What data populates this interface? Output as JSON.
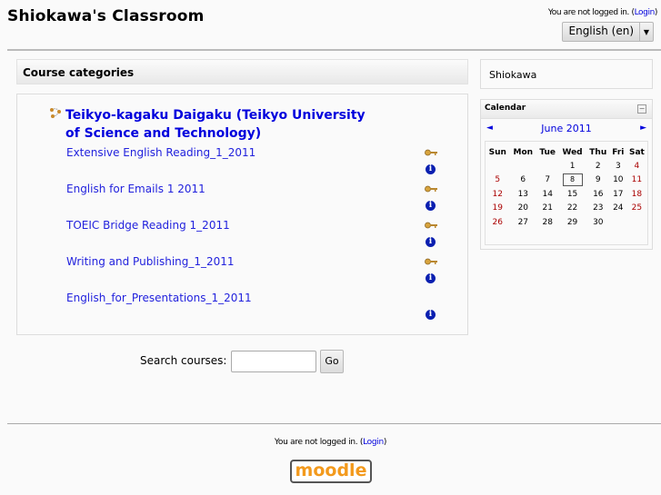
{
  "header": {
    "title": "Shiokawa's Classroom",
    "login_text": "You are not logged in. (",
    "login_link": "Login",
    "login_close": ")",
    "language": "English (en)"
  },
  "main": {
    "block_title": "Course categories",
    "category": {
      "icon": "category-icon",
      "title": "Teikyo-kagaku Daigaku (Teikyo University of Science and Technology)"
    },
    "courses": [
      {
        "name": "Extensive English Reading_1_2011",
        "guest_key": true,
        "info": true
      },
      {
        "name": "English for Emails 1 2011",
        "guest_key": true,
        "info": true
      },
      {
        "name": "TOEIC Bridge Reading 1_2011",
        "guest_key": true,
        "info": true
      },
      {
        "name": "Writing and Publishing_1_2011",
        "guest_key": true,
        "info": true
      },
      {
        "name": "English_for_Presentations_1_2011",
        "guest_key": false,
        "info": true
      }
    ],
    "search": {
      "label": "Search courses:",
      "value": "",
      "button": "Go"
    }
  },
  "sidebar": {
    "block1_text": "Shiokawa",
    "calendar": {
      "title": "Calendar",
      "collapse_icon": "−",
      "prev_icon": "◄",
      "next_icon": "►",
      "month": "June 2011",
      "weekdays": [
        "Sun",
        "Mon",
        "Tue",
        "Wed",
        "Thu",
        "Fri",
        "Sat"
      ],
      "weeks": [
        [
          "",
          "",
          "",
          "1",
          "2",
          "3",
          "4"
        ],
        [
          "5",
          "6",
          "7",
          "8",
          "9",
          "10",
          "11"
        ],
        [
          "12",
          "13",
          "14",
          "15",
          "16",
          "17",
          "18"
        ],
        [
          "19",
          "20",
          "21",
          "22",
          "23",
          "24",
          "25"
        ],
        [
          "26",
          "27",
          "28",
          "29",
          "30",
          "",
          ""
        ]
      ],
      "today": "8",
      "weekend_color": "#aa0000"
    }
  },
  "footer": {
    "login_text": "You are not logged in. (",
    "login_link": "Login",
    "login_close": ")",
    "logo_text": "moodle"
  },
  "colors": {
    "link": "#0000dd",
    "logo_orange": "#f39a1d"
  }
}
